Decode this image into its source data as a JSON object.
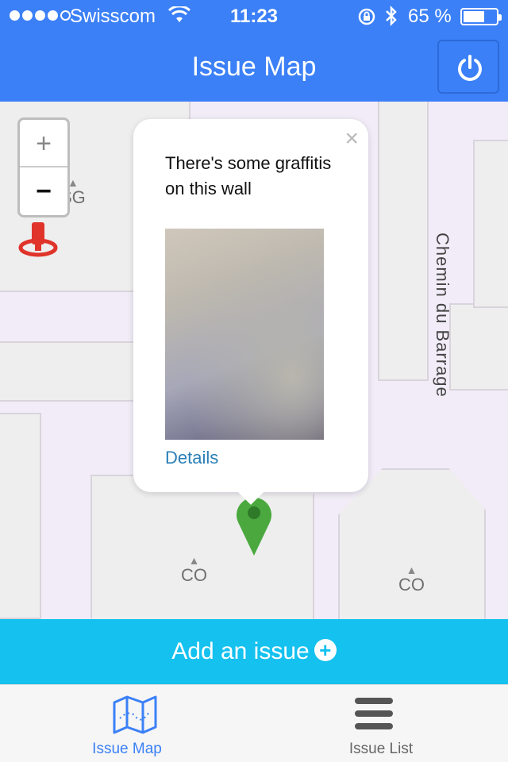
{
  "status": {
    "carrier": "Swisscom",
    "time": "11:23",
    "battery": "65 %",
    "battery_level": 0.65
  },
  "nav": {
    "title": "Issue Map"
  },
  "map": {
    "road_name": "Chemin du Barrage",
    "labels": [
      "SG",
      "CO",
      "CO"
    ],
    "zoom_in": "+",
    "zoom_out": "−"
  },
  "popup": {
    "close": "×",
    "text": "There's some graffitis on this wall",
    "details_link": "Details"
  },
  "add_issue": {
    "label": "Add an issue",
    "plus": "+"
  },
  "tabs": [
    {
      "label": "Issue Map",
      "icon": "map-icon",
      "active": true
    },
    {
      "label": "Issue List",
      "icon": "list-icon",
      "active": false
    }
  ],
  "colors": {
    "primary": "#3b80f7",
    "accent": "#14c1ef",
    "link": "#2a7fb7",
    "marker": "#4aa83f"
  }
}
